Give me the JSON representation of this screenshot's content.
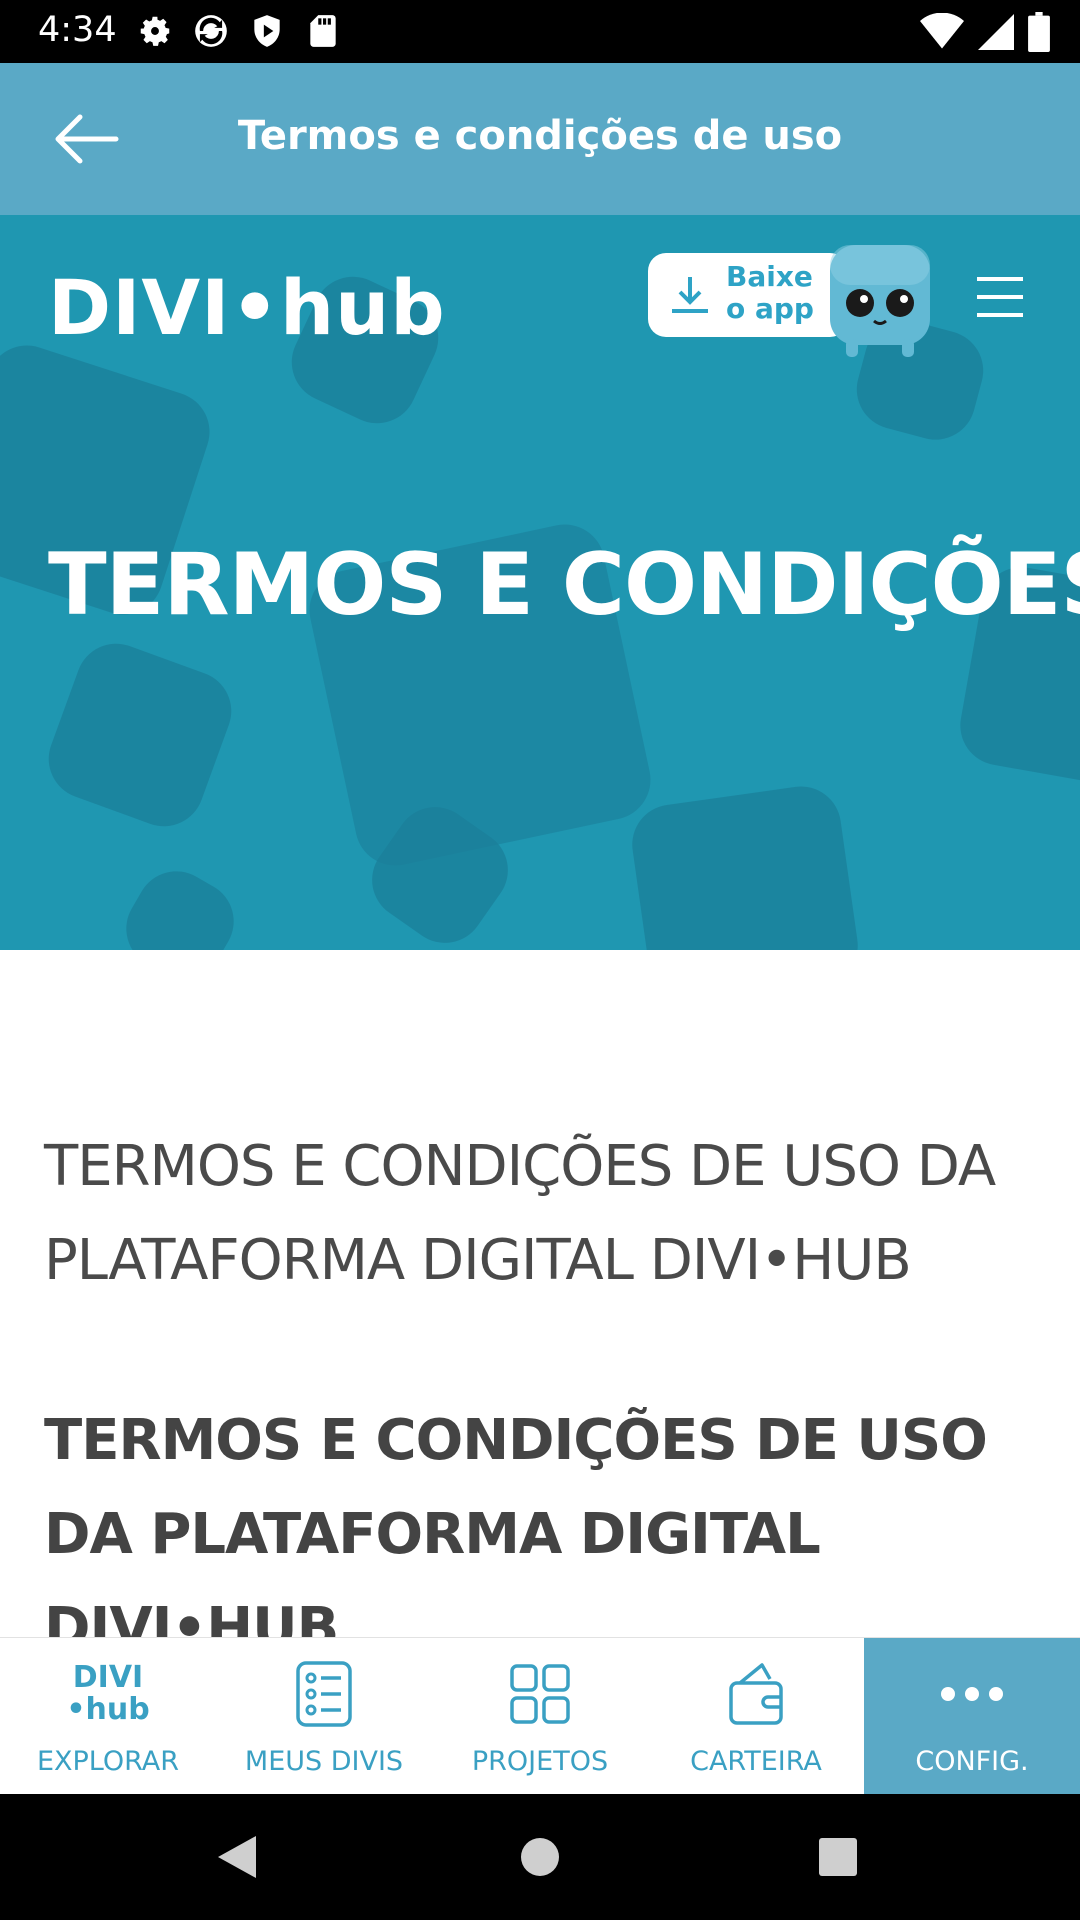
{
  "status_bar": {
    "time": "4:34"
  },
  "app_bar": {
    "title": "Termos e condições de uso"
  },
  "hero": {
    "logo": "DIVI•hub",
    "download_line1": "Baixe",
    "download_line2": "o app",
    "title": "TERMOS E CONDIÇÕES"
  },
  "content": {
    "heading_light": "TERMOS E CONDIÇÕES DE USO DA PLATAFORMA DIGITAL DIVI•HUB",
    "heading_bold": "TERMOS E CONDIÇÕES DE USO DA PLATAFORMA DIGITAL DIVI•HUB"
  },
  "bottom_nav": {
    "explorar_logo_line1": "DIVI",
    "explorar_logo_line2": "•hub",
    "items": [
      {
        "label": "EXPLORAR",
        "icon": "divi-hub-logo-icon"
      },
      {
        "label": "MEUS DIVIS",
        "icon": "list-icon"
      },
      {
        "label": "PROJETOS",
        "icon": "grid-icon"
      },
      {
        "label": "CARTEIRA",
        "icon": "wallet-icon"
      },
      {
        "label": "CONFIG.",
        "icon": "more-icon",
        "active": true
      }
    ]
  },
  "colors": {
    "app_bar": "#5aa9c6",
    "hero_bg": "#1f97b1",
    "accent": "#3aa0c3"
  }
}
